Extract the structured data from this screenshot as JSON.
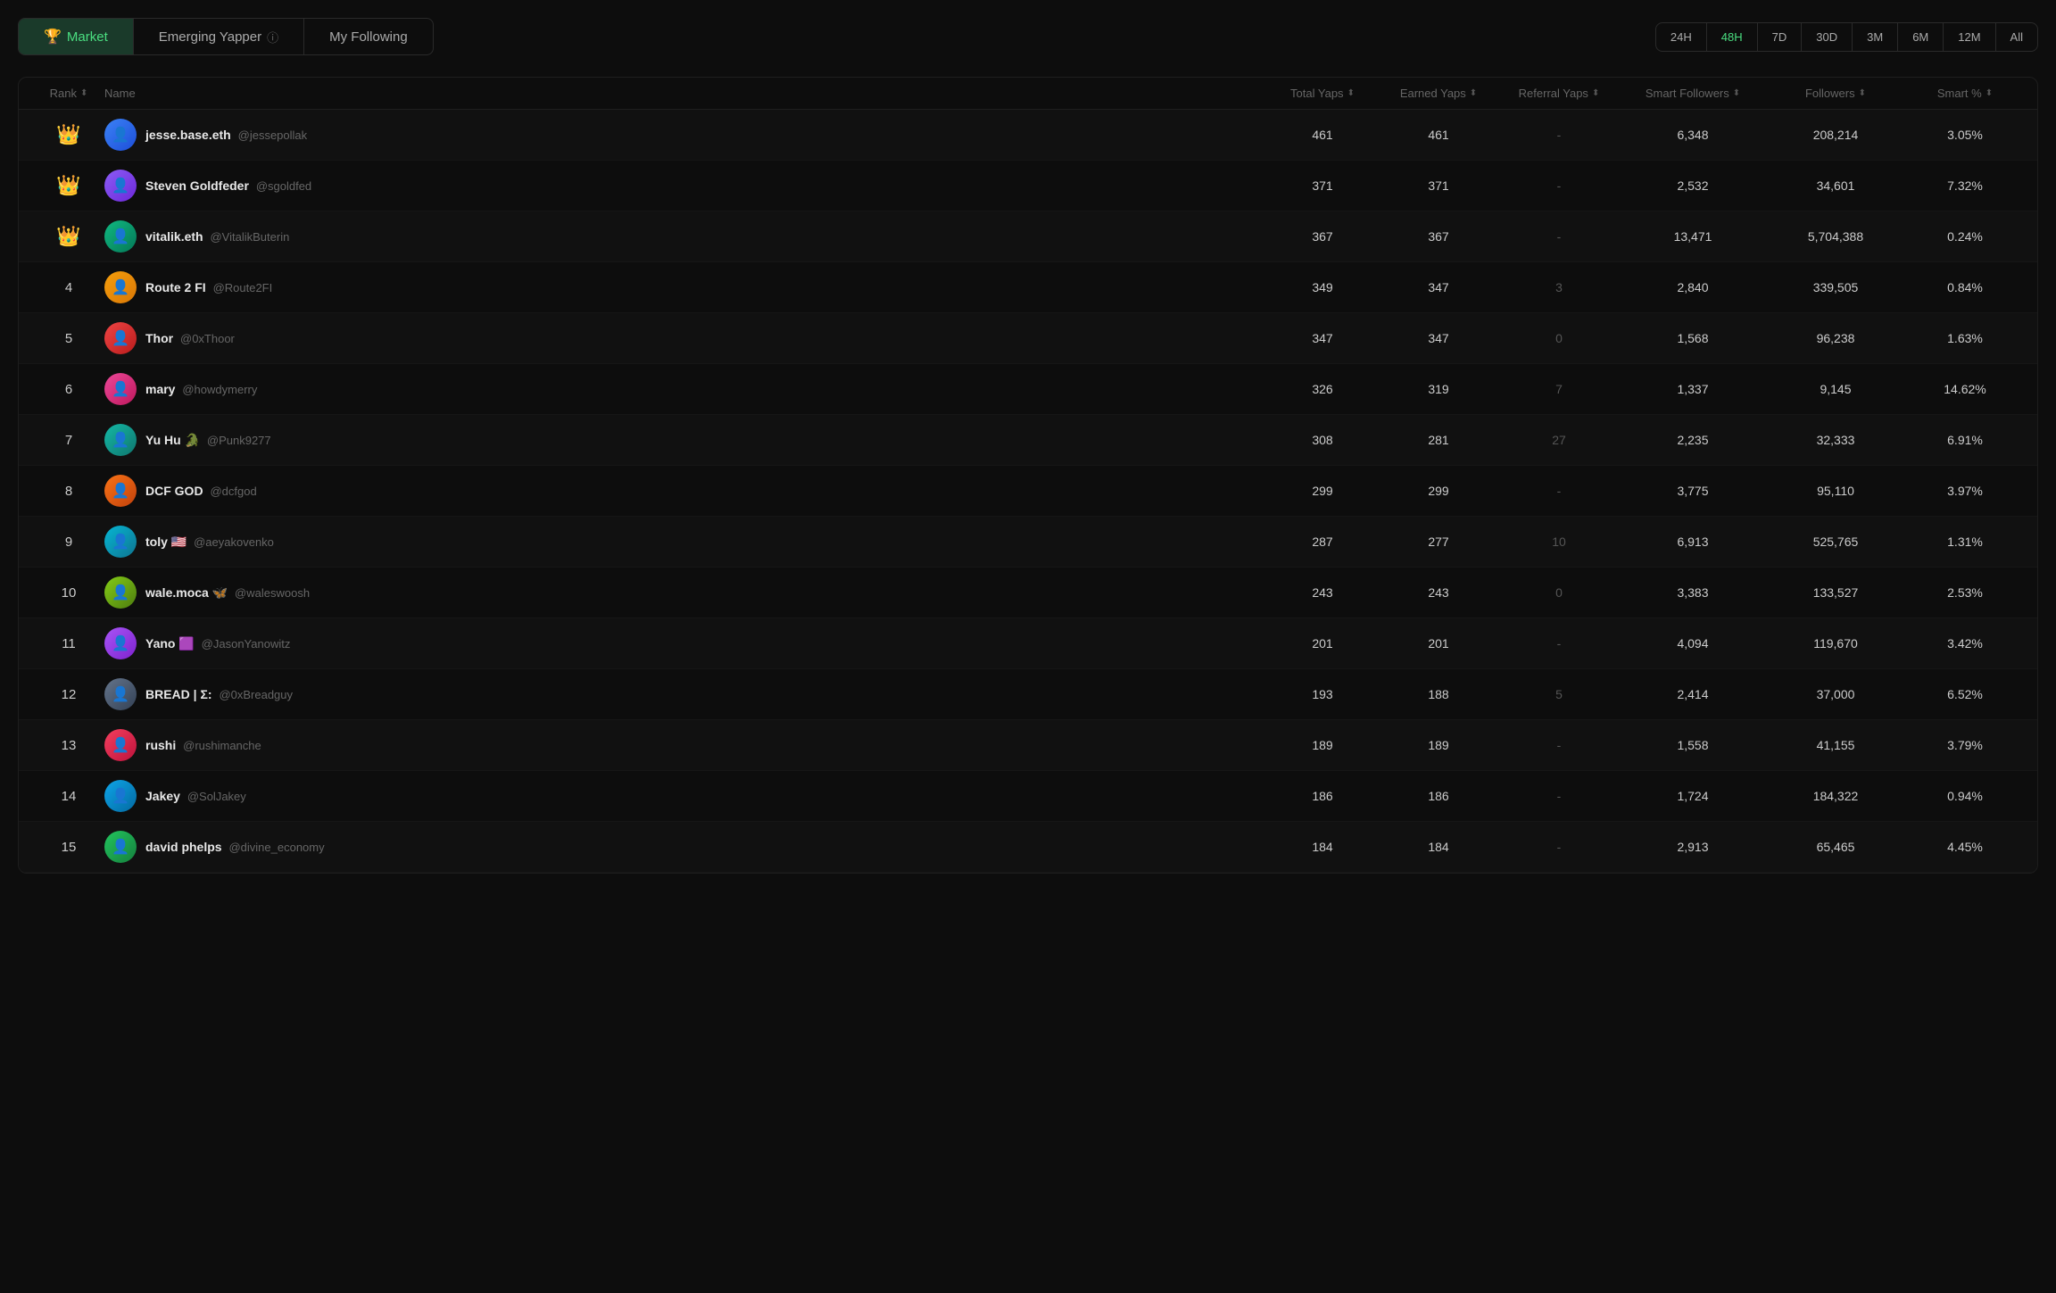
{
  "tabs": [
    {
      "id": "market",
      "label": "Market",
      "icon": "🏆",
      "active": true
    },
    {
      "id": "emerging",
      "label": "Emerging Yapper",
      "icon": "",
      "active": false,
      "info": true
    },
    {
      "id": "following",
      "label": "My Following",
      "icon": "",
      "active": false
    }
  ],
  "time_filters": [
    {
      "id": "24h",
      "label": "24H",
      "active": false
    },
    {
      "id": "48h",
      "label": "48H",
      "active": true
    },
    {
      "id": "7d",
      "label": "7D",
      "active": false
    },
    {
      "id": "30d",
      "label": "30D",
      "active": false
    },
    {
      "id": "3m",
      "label": "3M",
      "active": false
    },
    {
      "id": "6m",
      "label": "6M",
      "active": false
    },
    {
      "id": "12m",
      "label": "12M",
      "active": false
    },
    {
      "id": "all",
      "label": "All",
      "active": false
    }
  ],
  "columns": [
    {
      "id": "rank",
      "label": "Rank",
      "sortable": true
    },
    {
      "id": "name",
      "label": "Name",
      "sortable": false
    },
    {
      "id": "total_yaps",
      "label": "Total Yaps",
      "sortable": true
    },
    {
      "id": "earned_yaps",
      "label": "Earned Yaps",
      "sortable": true
    },
    {
      "id": "referral_yaps",
      "label": "Referral Yaps",
      "sortable": true
    },
    {
      "id": "smart_followers",
      "label": "Smart Followers",
      "sortable": true
    },
    {
      "id": "followers",
      "label": "Followers",
      "sortable": true
    },
    {
      "id": "smart_pct",
      "label": "Smart %",
      "sortable": true
    }
  ],
  "rows": [
    {
      "rank": "crown",
      "name": "jesse.base.eth",
      "handle": "@jessepollak",
      "total_yaps": "461",
      "earned_yaps": "461",
      "referral_yaps": "-",
      "smart_followers": "6,348",
      "followers": "208,214",
      "smart_pct": "3.05%",
      "av_class": "av-1",
      "av_emoji": "👤"
    },
    {
      "rank": "crown",
      "name": "Steven Goldfeder",
      "handle": "@sgoldfed",
      "total_yaps": "371",
      "earned_yaps": "371",
      "referral_yaps": "-",
      "smart_followers": "2,532",
      "followers": "34,601",
      "smart_pct": "7.32%",
      "av_class": "av-2",
      "av_emoji": "👤"
    },
    {
      "rank": "crown",
      "name": "vitalik.eth",
      "handle": "@VitalikButerin",
      "total_yaps": "367",
      "earned_yaps": "367",
      "referral_yaps": "-",
      "smart_followers": "13,471",
      "followers": "5,704,388",
      "smart_pct": "0.24%",
      "av_class": "av-3",
      "av_emoji": "👤"
    },
    {
      "rank": "4",
      "name": "Route 2 FI",
      "handle": "@Route2FI",
      "total_yaps": "349",
      "earned_yaps": "347",
      "referral_yaps": "3",
      "smart_followers": "2,840",
      "followers": "339,505",
      "smart_pct": "0.84%",
      "av_class": "av-4",
      "av_emoji": "👤"
    },
    {
      "rank": "5",
      "name": "Thor",
      "handle": "@0xThoor",
      "total_yaps": "347",
      "earned_yaps": "347",
      "referral_yaps": "0",
      "smart_followers": "1,568",
      "followers": "96,238",
      "smart_pct": "1.63%",
      "av_class": "av-5",
      "av_emoji": "👤"
    },
    {
      "rank": "6",
      "name": "mary",
      "handle": "@howdymerry",
      "total_yaps": "326",
      "earned_yaps": "319",
      "referral_yaps": "7",
      "smart_followers": "1,337",
      "followers": "9,145",
      "smart_pct": "14.62%",
      "av_class": "av-6",
      "av_emoji": "👤"
    },
    {
      "rank": "7",
      "name": "Yu Hu 🐊",
      "handle": "@Punk9277",
      "total_yaps": "308",
      "earned_yaps": "281",
      "referral_yaps": "27",
      "smart_followers": "2,235",
      "followers": "32,333",
      "smart_pct": "6.91%",
      "av_class": "av-7",
      "av_emoji": "👤"
    },
    {
      "rank": "8",
      "name": "DCF GOD",
      "handle": "@dcfgod",
      "total_yaps": "299",
      "earned_yaps": "299",
      "referral_yaps": "-",
      "smart_followers": "3,775",
      "followers": "95,110",
      "smart_pct": "3.97%",
      "av_class": "av-8",
      "av_emoji": "👤"
    },
    {
      "rank": "9",
      "name": "toly 🇺🇸",
      "handle": "@aeyakovenko",
      "total_yaps": "287",
      "earned_yaps": "277",
      "referral_yaps": "10",
      "smart_followers": "6,913",
      "followers": "525,765",
      "smart_pct": "1.31%",
      "av_class": "av-9",
      "av_emoji": "👤"
    },
    {
      "rank": "10",
      "name": "wale.moca 🦋",
      "handle": "@waleswoosh",
      "total_yaps": "243",
      "earned_yaps": "243",
      "referral_yaps": "0",
      "smart_followers": "3,383",
      "followers": "133,527",
      "smart_pct": "2.53%",
      "av_class": "av-10",
      "av_emoji": "👤"
    },
    {
      "rank": "11",
      "name": "Yano 🟪",
      "handle": "@JasonYanowitz",
      "total_yaps": "201",
      "earned_yaps": "201",
      "referral_yaps": "-",
      "smart_followers": "4,094",
      "followers": "119,670",
      "smart_pct": "3.42%",
      "av_class": "av-11",
      "av_emoji": "👤"
    },
    {
      "rank": "12",
      "name": "BREAD | Σ:",
      "handle": "@0xBreadguy",
      "total_yaps": "193",
      "earned_yaps": "188",
      "referral_yaps": "5",
      "smart_followers": "2,414",
      "followers": "37,000",
      "smart_pct": "6.52%",
      "av_class": "av-12",
      "av_emoji": "👤"
    },
    {
      "rank": "13",
      "name": "rushi",
      "handle": "@rushimanche",
      "total_yaps": "189",
      "earned_yaps": "189",
      "referral_yaps": "-",
      "smart_followers": "1,558",
      "followers": "41,155",
      "smart_pct": "3.79%",
      "av_class": "av-13",
      "av_emoji": "👤"
    },
    {
      "rank": "14",
      "name": "Jakey",
      "handle": "@SolJakey",
      "total_yaps": "186",
      "earned_yaps": "186",
      "referral_yaps": "-",
      "smart_followers": "1,724",
      "followers": "184,322",
      "smart_pct": "0.94%",
      "av_class": "av-14",
      "av_emoji": "👤"
    },
    {
      "rank": "15",
      "name": "david phelps",
      "handle": "@divine_economy",
      "total_yaps": "184",
      "earned_yaps": "184",
      "referral_yaps": "-",
      "smart_followers": "2,913",
      "followers": "65,465",
      "smart_pct": "4.45%",
      "av_class": "av-15",
      "av_emoji": "👤"
    }
  ]
}
